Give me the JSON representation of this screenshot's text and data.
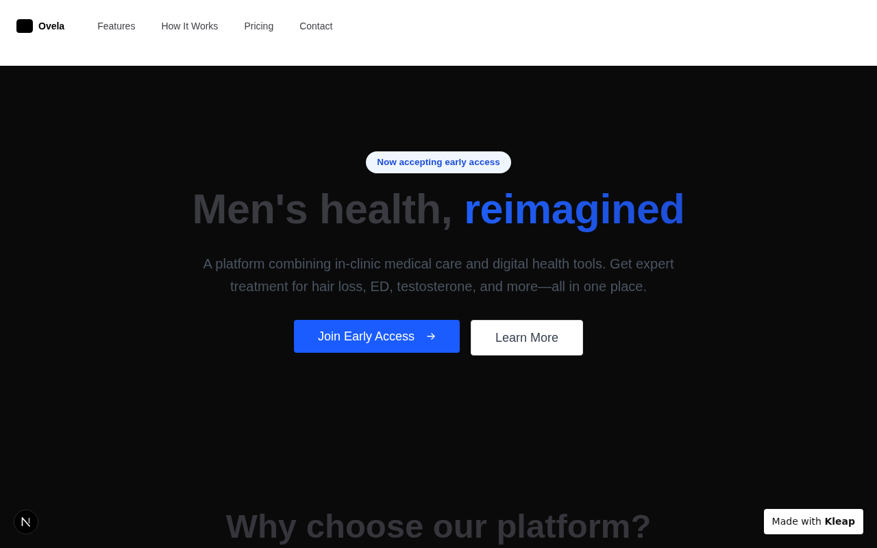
{
  "header": {
    "brand": "Ovela",
    "nav_links": [
      "Features",
      "How It Works",
      "Pricing",
      "Contact"
    ]
  },
  "hero": {
    "badge": "Now accepting early access",
    "heading": "Men's health,",
    "heading_highlight": "reimagined",
    "subtitle": "A platform combining in-clinic medical care and digital health tools. Get expert treatment for hair loss, ED, testosterone, and more—all in one place.",
    "buttons": [
      {
        "kind": "primary",
        "label": "Join Early Access"
      },
      {
        "kind": "secondary",
        "label": "Learn More"
      }
    ]
  },
  "next_section": {
    "heading": "Why choose our platform?"
  },
  "made_with_badge": "Made with **Kleap**"
}
